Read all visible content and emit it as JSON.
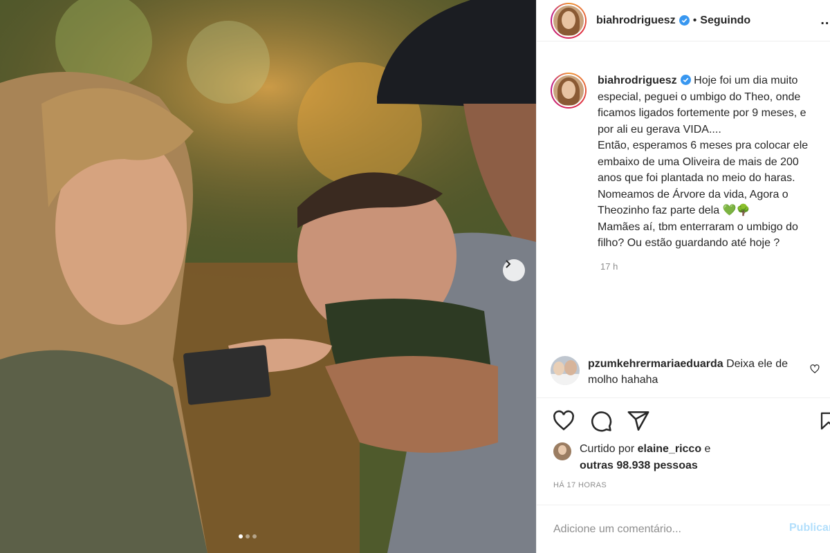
{
  "post": {
    "username": "biahrodriguesz",
    "separator": "•",
    "follow_status": "Seguindo",
    "more_label": "...",
    "caption": "Hoje foi um dia muito especial, peguei o umbigo do Theo, onde ficamos ligados fortemente por 9 meses, e por ali eu gerava VIDA....\nEntão, esperamos 6 meses pra colocar ele embaixo de uma Oliveira de mais de 200 anos que foi plantada no meio do haras. Nomeamos de Árvore da vida, Agora o Theozinho faz parte dela 💚🌳\nMamães aí, tbm enterraram o umbigo do filho? Ou estão guardando até hoje ?",
    "caption_time": "17 h"
  },
  "comment": {
    "username": "pzumkehrermariaeduarda",
    "text": "Deixa ele de molho hahaha"
  },
  "likes": {
    "prefix": "Curtido por ",
    "user": "elaine_ricco",
    "suffix": " e",
    "others": "outras 98.938 pessoas"
  },
  "timestamp": "HÁ 17 HORAS",
  "add_comment": {
    "placeholder": "Adicione um comentário...",
    "publish_label": "Publicar"
  },
  "carousel": {
    "slides": 3,
    "active": 1
  },
  "colors": {
    "verified": "#3897f0",
    "publish_disabled": "#b2dffc",
    "muted": "#8e8e8e"
  },
  "icons": [
    "verified-icon",
    "more-options-icon",
    "heart-icon",
    "comment-icon",
    "share-icon",
    "bookmark-icon",
    "chevron-right-icon"
  ]
}
